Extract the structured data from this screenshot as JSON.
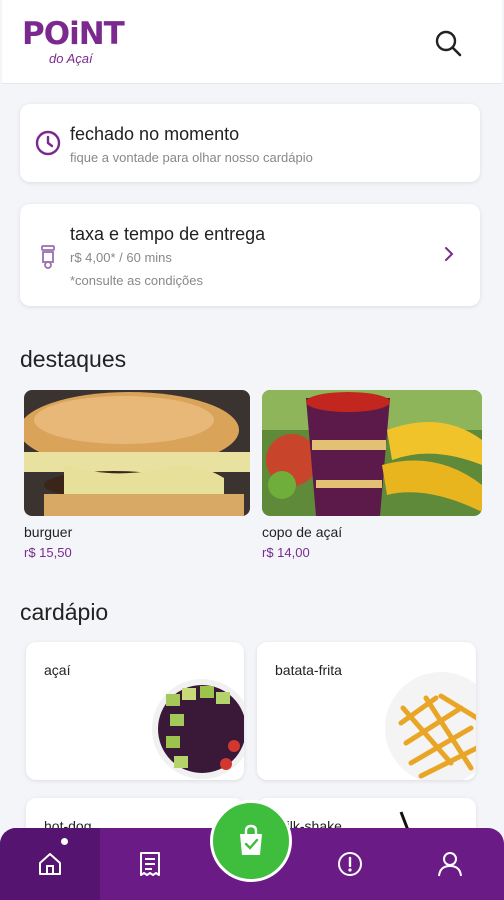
{
  "app": {
    "logo_text": "POiNT",
    "logo_sub": "do Açaí",
    "accent": "#7a2a8f",
    "cart_color": "#3fbd3d"
  },
  "header": {
    "search_icon": "search-icon"
  },
  "status": {
    "title": "fechado no momento",
    "subtitle": "fique a vontade para olhar nosso cardápio",
    "icon": "clock-icon"
  },
  "delivery": {
    "title": "taxa e tempo de entrega",
    "price_time": "r$ 4,00* / 60 mins",
    "note": "*consulte as condições",
    "icon": "scooter-icon"
  },
  "highlights": {
    "title": "destaques",
    "items": [
      {
        "name": "burguer",
        "price": "r$ 15,50"
      },
      {
        "name": "copo de açaí",
        "price": "r$ 14,00"
      }
    ]
  },
  "menu": {
    "title": "cardápio",
    "categories": [
      {
        "label": "açaí"
      },
      {
        "label": "batata-frita"
      },
      {
        "label": "hot-dog"
      },
      {
        "label": "milk-shake"
      }
    ]
  },
  "bottom_nav": {
    "items": [
      "home-icon",
      "receipt-icon",
      "cart-icon",
      "info-icon",
      "profile-icon"
    ]
  }
}
